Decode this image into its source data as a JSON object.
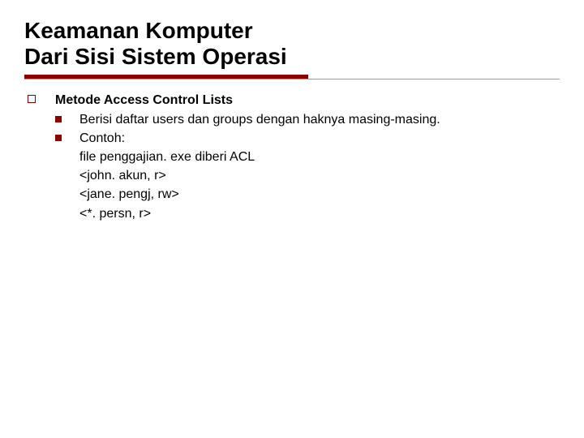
{
  "title_line1": "Keamanan Komputer",
  "title_line2": "Dari Sisi Sistem Operasi",
  "content": {
    "heading": "Metode Access Control Lists",
    "items": [
      {
        "text": "Berisi daftar users dan groups dengan haknya masing-masing.",
        "lines": []
      },
      {
        "text": "Contoh:",
        "lines": [
          "file penggajian. exe diberi ACL",
          "<john. akun, r>",
          "<jane. pengj, rw>",
          "<*. persn, r>"
        ]
      }
    ]
  }
}
